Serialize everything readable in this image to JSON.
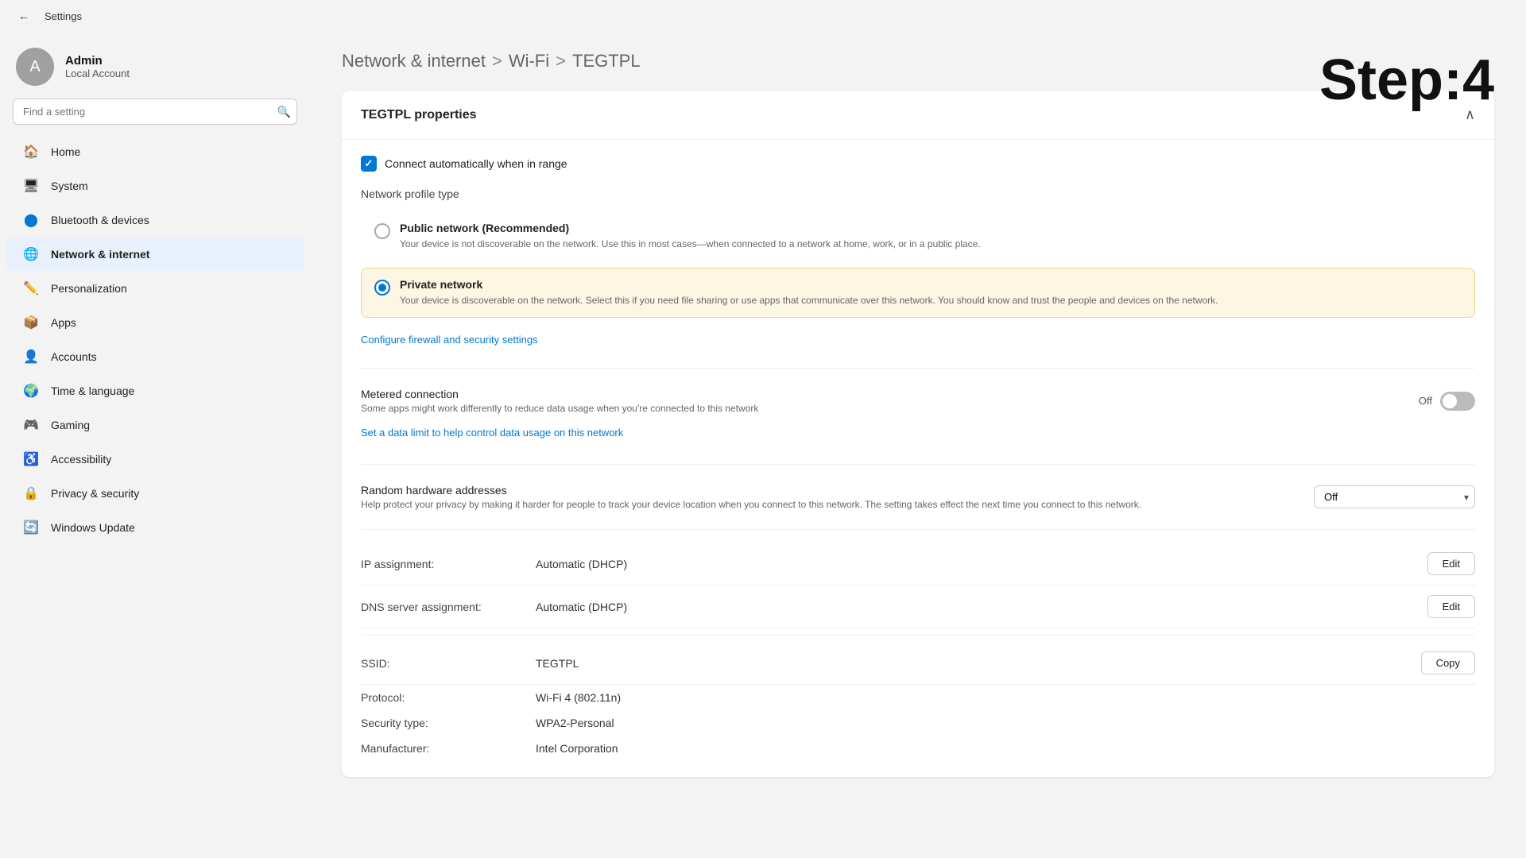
{
  "titlebar": {
    "back_label": "←",
    "title": "Settings"
  },
  "user": {
    "name": "Admin",
    "type": "Local Account",
    "avatar_initial": "A"
  },
  "search": {
    "placeholder": "Find a setting"
  },
  "nav": {
    "items": [
      {
        "id": "home",
        "label": "Home",
        "icon": "🏠"
      },
      {
        "id": "system",
        "label": "System",
        "icon": "🖥"
      },
      {
        "id": "bluetooth",
        "label": "Bluetooth & devices",
        "icon": "🔵"
      },
      {
        "id": "network",
        "label": "Network & internet",
        "icon": "🌐",
        "active": true
      },
      {
        "id": "personalization",
        "label": "Personalization",
        "icon": "✏️"
      },
      {
        "id": "apps",
        "label": "Apps",
        "icon": "📦"
      },
      {
        "id": "accounts",
        "label": "Accounts",
        "icon": "👤"
      },
      {
        "id": "timelanguage",
        "label": "Time & language",
        "icon": "🌍"
      },
      {
        "id": "gaming",
        "label": "Gaming",
        "icon": "🎮"
      },
      {
        "id": "accessibility",
        "label": "Accessibility",
        "icon": "♿"
      },
      {
        "id": "privacy",
        "label": "Privacy & security",
        "icon": "🔒"
      },
      {
        "id": "windowsupdate",
        "label": "Windows Update",
        "icon": "🔄"
      }
    ]
  },
  "breadcrumb": {
    "part1": "Network & internet",
    "sep1": ">",
    "part2": "Wi-Fi",
    "sep2": ">",
    "part3": "TEGTPL"
  },
  "step": "Step:4",
  "card": {
    "title": "TEGTPL properties",
    "connect_auto_label": "Connect automatically when in range",
    "connect_auto_checked": true,
    "network_profile_label": "Network profile type",
    "radio_public": {
      "title": "Public network (Recommended)",
      "desc": "Your device is not discoverable on the network. Use this in most cases—when connected to a network at home, work, or in a public place."
    },
    "radio_private": {
      "title": "Private network",
      "desc": "Your device is discoverable on the network. Select this if you need file sharing or use apps that communicate over this network. You should know and trust the people and devices on the network."
    },
    "firewall_link": "Configure firewall and security settings",
    "metered": {
      "title": "Metered connection",
      "desc": "Some apps might work differently to reduce data usage when you're connected to this network",
      "toggle_state": "off",
      "toggle_label": "Off"
    },
    "data_limit_link": "Set a data limit to help control data usage on this network",
    "random_hw": {
      "title": "Random hardware addresses",
      "desc": "Help protect your privacy by making it harder for people to track your device location when you connect to this network. The setting takes effect the next time you connect to this network.",
      "value": "Off"
    },
    "ip_assignment": {
      "label": "IP assignment:",
      "value": "Automatic (DHCP)",
      "action": "Edit"
    },
    "dns_assignment": {
      "label": "DNS server assignment:",
      "value": "Automatic (DHCP)",
      "action": "Edit"
    },
    "ssid": {
      "label": "SSID:",
      "value": "TEGTPL",
      "action": "Copy"
    },
    "protocol": {
      "label": "Protocol:",
      "value": "Wi-Fi 4 (802.11n)"
    },
    "security_type": {
      "label": "Security type:",
      "value": "WPA2-Personal"
    },
    "manufacturer": {
      "label": "Manufacturer:",
      "value": "Intel Corporation"
    }
  }
}
